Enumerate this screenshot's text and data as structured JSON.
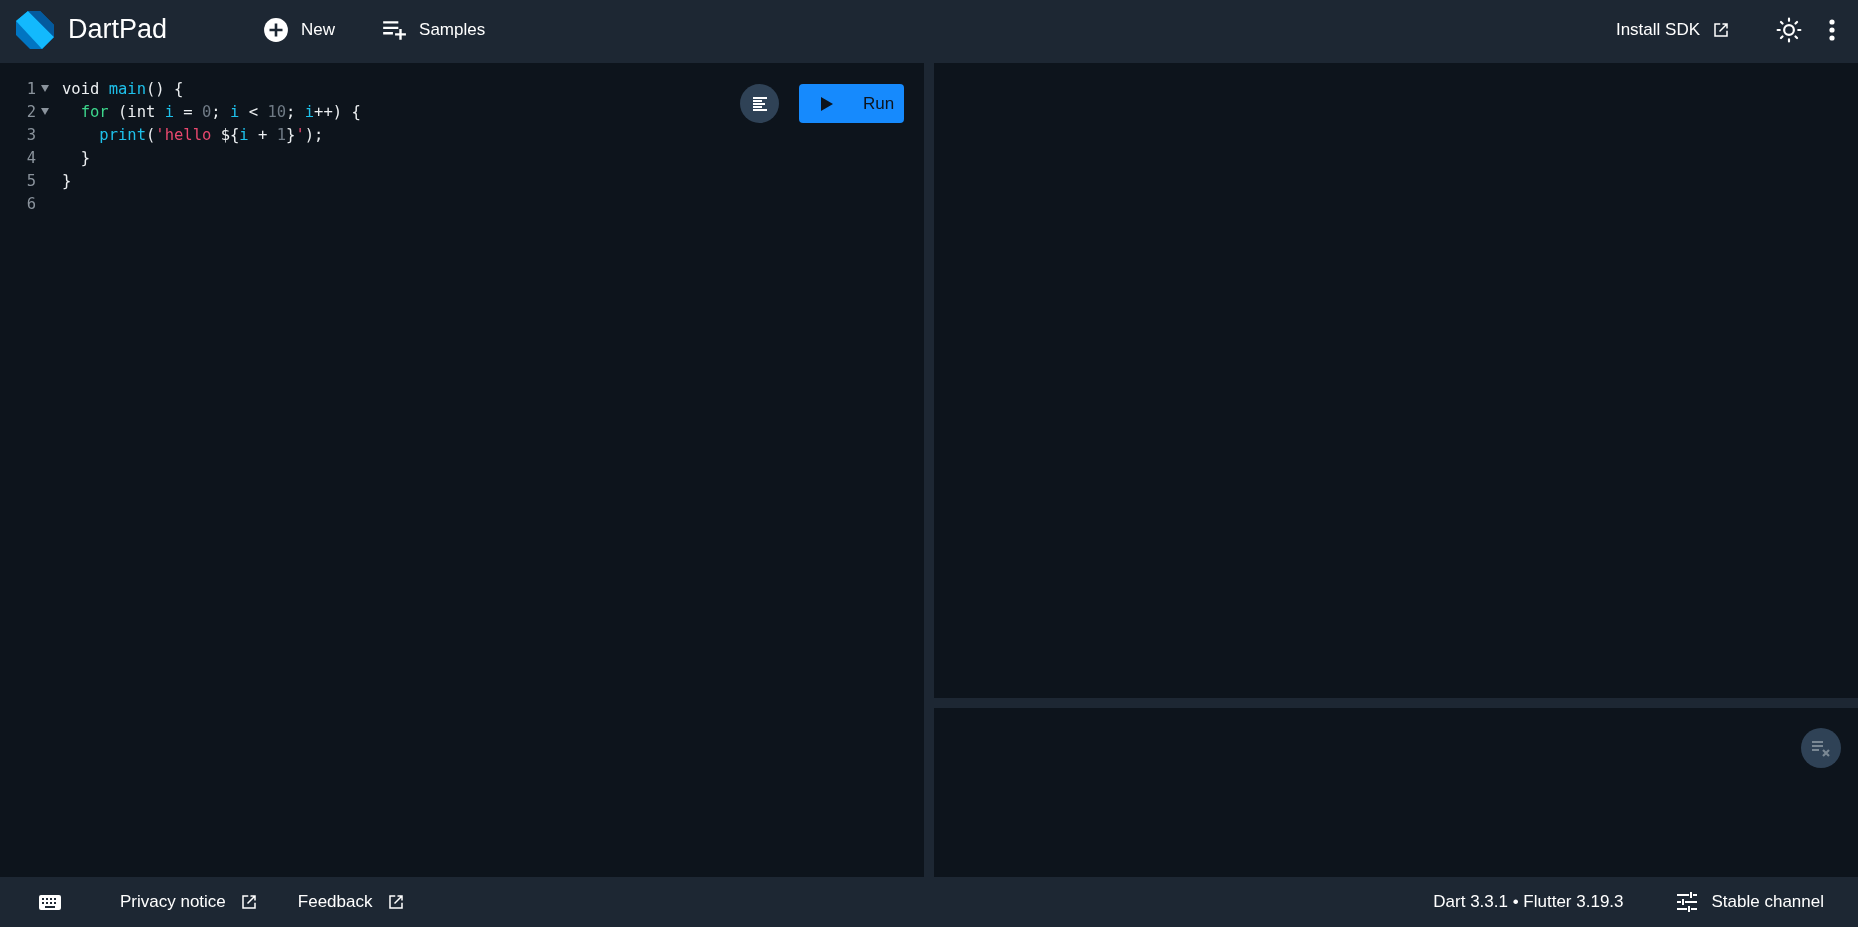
{
  "header": {
    "title": "DartPad",
    "actions": [
      {
        "label": "New"
      },
      {
        "label": "Samples"
      }
    ],
    "install_link": "Install SDK"
  },
  "editor": {
    "lines": [
      {
        "number": "1",
        "foldable": true,
        "tokens": [
          {
            "text": "void ",
            "kind": "plain"
          },
          {
            "text": "main",
            "kind": "identifier"
          },
          {
            "text": "() {",
            "kind": "plain"
          }
        ]
      },
      {
        "number": "2",
        "foldable": true,
        "tokens": [
          {
            "text": "  for",
            "kind": "control"
          },
          {
            "text": " (int ",
            "kind": "plain"
          },
          {
            "text": "i",
            "kind": "identifier"
          },
          {
            "text": " = ",
            "kind": "plain"
          },
          {
            "text": "0",
            "kind": "number"
          },
          {
            "text": "; ",
            "kind": "plain"
          },
          {
            "text": "i",
            "kind": "identifier"
          },
          {
            "text": " < ",
            "kind": "plain"
          },
          {
            "text": "10",
            "kind": "number"
          },
          {
            "text": "; ",
            "kind": "plain"
          },
          {
            "text": "i",
            "kind": "identifier"
          },
          {
            "text": "++) {",
            "kind": "plain"
          }
        ]
      },
      {
        "number": "3",
        "foldable": false,
        "tokens": [
          {
            "text": "    print",
            "kind": "identifier"
          },
          {
            "text": "(",
            "kind": "plain"
          },
          {
            "text": "'hello ",
            "kind": "string"
          },
          {
            "text": "${",
            "kind": "plain"
          },
          {
            "text": "i",
            "kind": "identifier"
          },
          {
            "text": " + ",
            "kind": "plain"
          },
          {
            "text": "1",
            "kind": "number"
          },
          {
            "text": "}",
            "kind": "plain"
          },
          {
            "text": "'",
            "kind": "string"
          },
          {
            "text": ");",
            "kind": "plain"
          }
        ]
      },
      {
        "number": "4",
        "foldable": false,
        "tokens": [
          {
            "text": "  }",
            "kind": "plain"
          }
        ]
      },
      {
        "number": "5",
        "foldable": false,
        "tokens": [
          {
            "text": "}",
            "kind": "plain"
          }
        ]
      },
      {
        "number": "6",
        "foldable": false
      }
    ],
    "run_button": "Run"
  },
  "footer": {
    "privacy_link": "Privacy notice",
    "feedback_link": "Feedback",
    "version": "Dart 3.3.1 • Flutter 3.19.3",
    "channel_button": "Stable channel"
  }
}
